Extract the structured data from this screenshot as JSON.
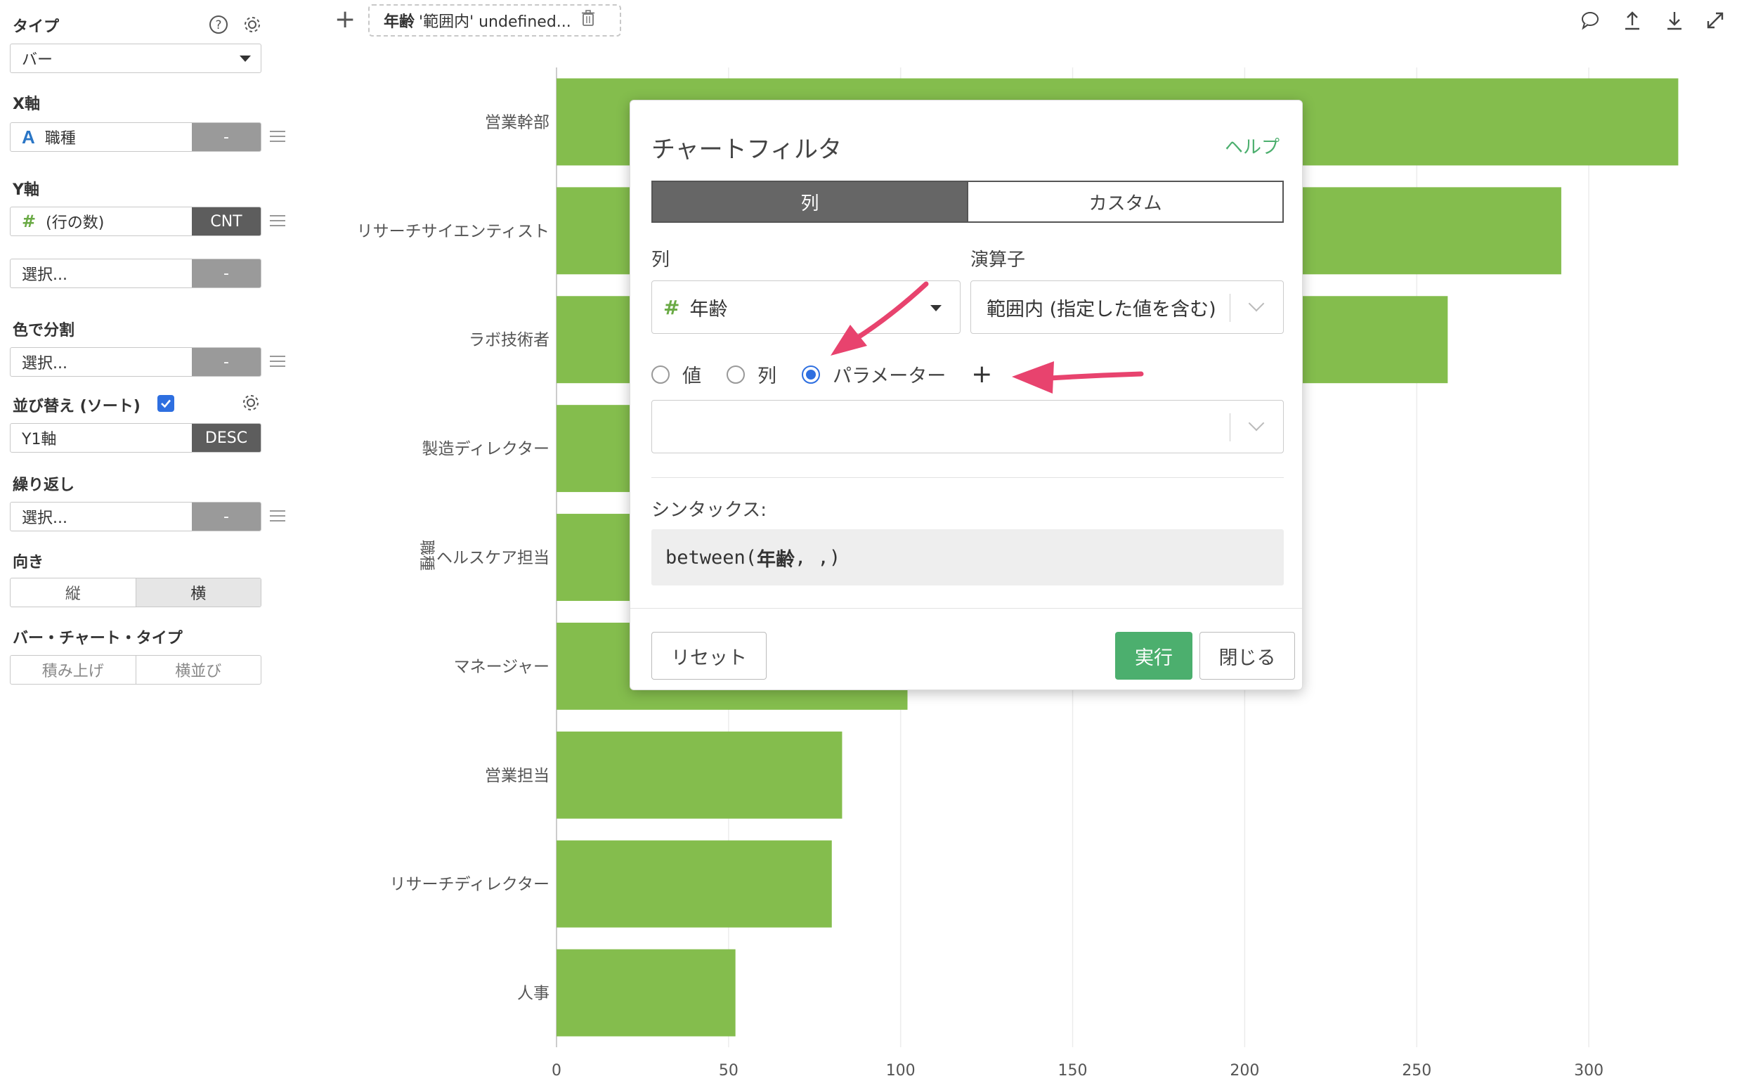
{
  "sidebar": {
    "type_label": "タイプ",
    "type_value": "バー",
    "x_label": "X軸",
    "x_field": {
      "icon": "A",
      "name": "職種",
      "agg": "-"
    },
    "y_label": "Y軸",
    "y_field": {
      "icon": "#",
      "name": "(行の数)",
      "agg": "CNT"
    },
    "y_extra": {
      "placeholder": "選択...",
      "agg": "-"
    },
    "color_label": "色で分割",
    "color_field": {
      "placeholder": "選択...",
      "agg": "-"
    },
    "sort_label": "並び替え (ソート)",
    "sort_field": {
      "name": "Y1軸",
      "agg": "DESC"
    },
    "repeat_label": "繰り返し",
    "repeat_field": {
      "placeholder": "選択...",
      "agg": "-"
    },
    "orientation_label": "向き",
    "orientation_options": [
      "縦",
      "横"
    ],
    "bar_type_label": "バー・チャート・タイプ",
    "bar_type_options": [
      "積み上げ",
      "横並び"
    ]
  },
  "topbar": {
    "add_symbol": "+",
    "filter_chip": {
      "field": "年齢",
      "text": "'範囲内' undefined..."
    },
    "icons": [
      "comment-icon",
      "upload-icon",
      "download-icon",
      "expand-icon"
    ]
  },
  "chart_data": {
    "type": "bar",
    "orientation": "horizontal",
    "ylabel": "職種",
    "categories": [
      "営業幹部",
      "リサーチサイエンティスト",
      "ラボ技術者",
      "製造ディレクター",
      "ヘルスケア担当",
      "マネージャー",
      "営業担当",
      "リサーチディレクター",
      "人事"
    ],
    "values": [
      326,
      292,
      259,
      145,
      131,
      102,
      83,
      80,
      52
    ],
    "xticks": [
      "0",
      "50",
      "100",
      "150",
      "200",
      "250",
      "300"
    ],
    "xlim": [
      0,
      330
    ],
    "bar_color": "#84bd4d",
    "grid": true
  },
  "modal": {
    "title": "チャートフィルタ",
    "help": "ヘルプ",
    "tabs": [
      "列",
      "カスタム"
    ],
    "column_label": "列",
    "column_icon": "#",
    "column_value": "年齢",
    "operator_label": "演算子",
    "operator_value": "範囲内 (指定した値を含む)",
    "radio_options": [
      "値",
      "列",
      "パラメーター"
    ],
    "radio_selected": "パラメーター",
    "add_symbol": "+",
    "param_value": "",
    "syntax_label": "シンタックス:",
    "syntax_prefix": "between(",
    "syntax_bold": "年齢",
    "syntax_suffix": ", ,)",
    "reset": "リセット",
    "run": "実行",
    "close": "閉じる"
  },
  "colors": {
    "accent_green": "#4caf6e",
    "bar_green": "#84bd4d",
    "arrow_pink": "#e8436e",
    "radio_blue": "#2e6fe0"
  }
}
